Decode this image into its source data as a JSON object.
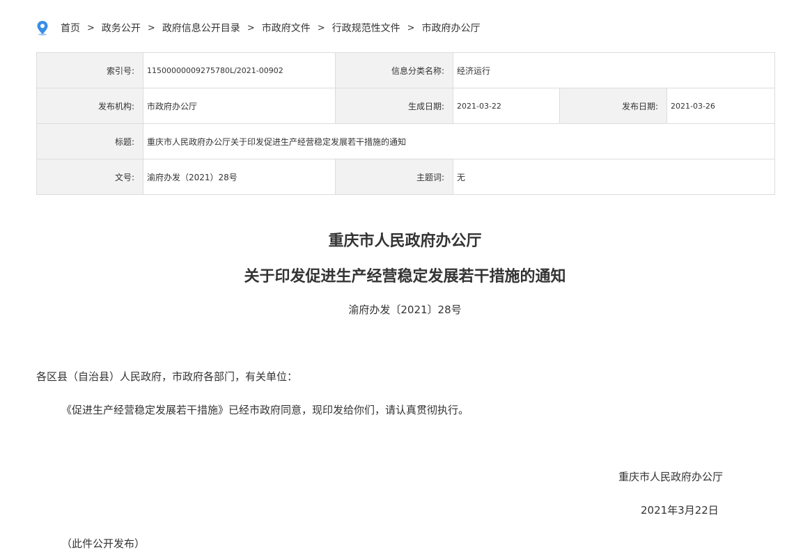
{
  "breadcrumb": {
    "items": [
      "首页",
      "政务公开",
      "政府信息公开目录",
      "市政府文件",
      "行政规范性文件",
      "市政府办公厅"
    ],
    "separator": ">"
  },
  "info": {
    "index_label": "索引号:",
    "index_value": "11500000009275780L/2021-00902",
    "category_label": "信息分类名称:",
    "category_value": "经济运行",
    "publisher_label": "发布机构:",
    "publisher_value": "市政府办公厅",
    "created_label": "生成日期:",
    "created_value": "2021-03-22",
    "published_label": "发布日期:",
    "published_value": "2021-03-26",
    "title_label": "标题:",
    "title_value": "重庆市人民政府办公厅关于印发促进生产经营稳定发展若干措施的通知",
    "docnum_label": "文号:",
    "docnum_value": "渝府办发（2021）28号",
    "subject_label": "主题词:",
    "subject_value": "无"
  },
  "document": {
    "title_line1": "重庆市人民政府办公厅",
    "title_line2": "关于印发促进生产经营稳定发展若干措施的通知",
    "number": "渝府办发〔2021〕28号",
    "address": "各区县（自治县）人民政府，市政府各部门，有关单位：",
    "body": "《促进生产经营稳定发展若干措施》已经市政府同意，现印发给你们，请认真贯彻执行。",
    "signature": "重庆市人民政府办公厅",
    "date": "2021年3月22日",
    "note": "（此件公开发布）"
  },
  "colors": {
    "pin_blue": "#3a8ee6",
    "label_bg": "#f2f2f2",
    "border": "#dcdcdc"
  },
  "icons": {
    "location": "location-pin-icon"
  }
}
